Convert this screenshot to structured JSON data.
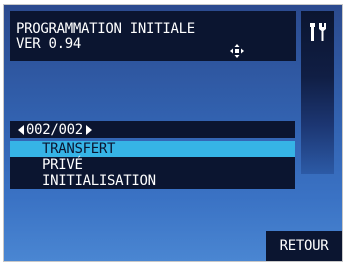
{
  "header": {
    "title": "PROGRAMMATION INITIALE",
    "version": "VER 0.94"
  },
  "icons": {
    "move": "move-cursor-icon",
    "tools": "wrench-screwdriver-icon"
  },
  "pager": {
    "label": "002/002"
  },
  "menu": {
    "items": [
      {
        "label": "TRANSFERT",
        "selected": true
      },
      {
        "label": "PRIVÉ",
        "selected": false
      },
      {
        "label": "INITIALISATION",
        "selected": false
      }
    ]
  },
  "footer": {
    "back_label": "RETOUR"
  },
  "colors": {
    "panel": "#0b1530",
    "highlight": "#36b4e6",
    "background": "#3262b0"
  }
}
